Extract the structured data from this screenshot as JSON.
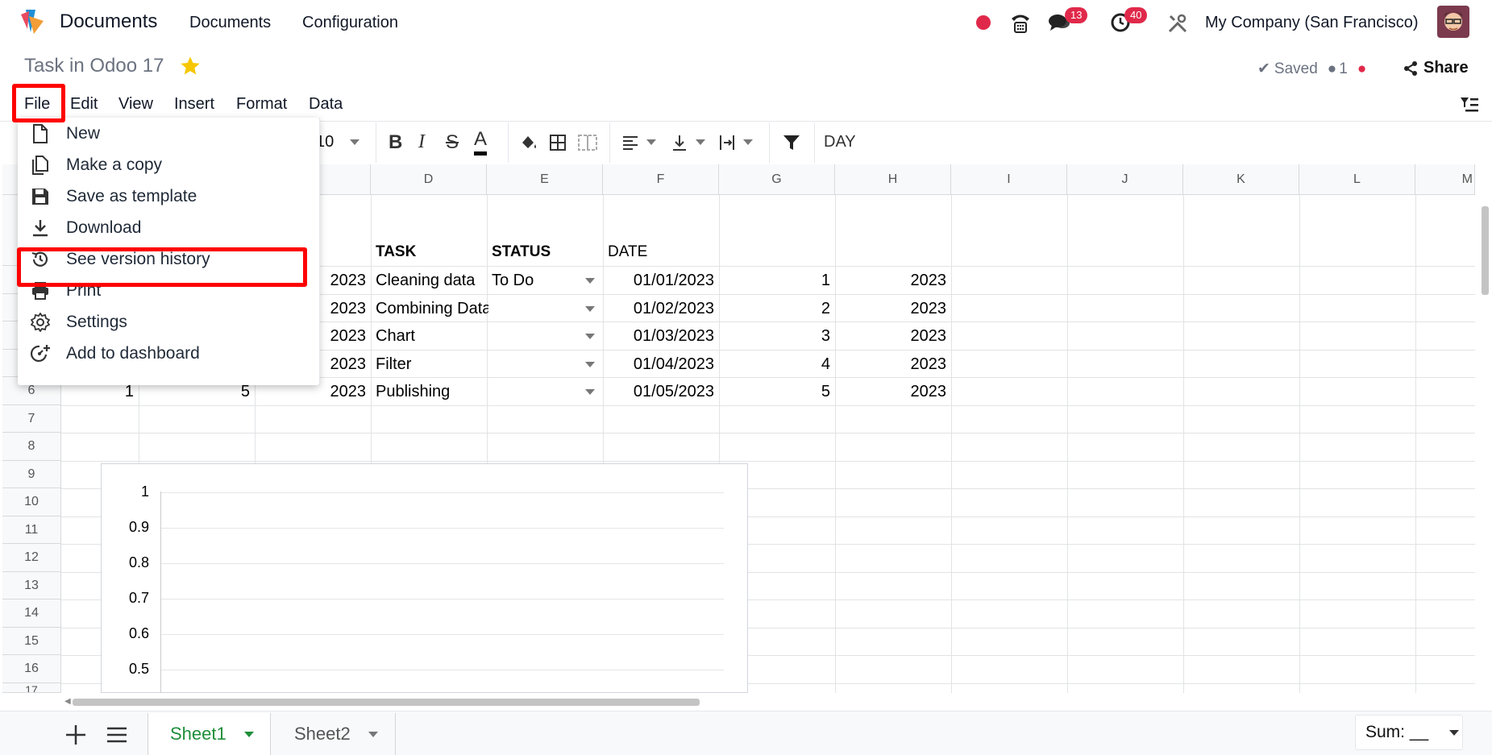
{
  "app": {
    "name": "Documents"
  },
  "topnav": {
    "menu_documents": "Documents",
    "menu_configuration": "Configuration",
    "chat_badge": "13",
    "activity_badge": "40",
    "company": "My Company (San Francisco)"
  },
  "doc": {
    "title": "Task in Odoo 17",
    "saved": "Saved",
    "users": "1",
    "share": "Share"
  },
  "menubar": {
    "file": "File",
    "edit": "Edit",
    "view": "View",
    "insert": "Insert",
    "format": "Format",
    "data": "Data"
  },
  "toolbar": {
    "font_size": "10",
    "cell_content": "DAY"
  },
  "file_menu": {
    "items": [
      {
        "label": "New",
        "icon": "file-icon"
      },
      {
        "label": "Make a copy",
        "icon": "copy-icon"
      },
      {
        "label": "Save as template",
        "icon": "save-icon"
      },
      {
        "label": "Download",
        "icon": "download-icon"
      },
      {
        "label": "See version history",
        "icon": "history-icon"
      },
      {
        "label": "Print",
        "icon": "print-icon"
      },
      {
        "label": "Settings",
        "icon": "gear-icon"
      },
      {
        "label": "Add to dashboard",
        "icon": "dashboard-add-icon"
      }
    ]
  },
  "sheet": {
    "columns": [
      "D",
      "E",
      "F",
      "G",
      "H",
      "I",
      "J",
      "K",
      "L",
      "M"
    ],
    "rows": [
      "6",
      "7",
      "8",
      "9",
      "10",
      "11",
      "12",
      "13",
      "14",
      "15",
      "16",
      "17"
    ],
    "headers": {
      "task": "TASK",
      "status": "STATUS",
      "date": "DATE"
    },
    "data": [
      {
        "c": "2023",
        "task": "Cleaning data",
        "status": "To Do",
        "date": "01/01/2023",
        "g": "1",
        "h": "2023"
      },
      {
        "c": "2023",
        "task": "Combining Data",
        "status": "",
        "date": "01/02/2023",
        "g": "2",
        "h": "2023"
      },
      {
        "c": "2023",
        "task": "Chart",
        "status": "",
        "date": "01/03/2023",
        "g": "3",
        "h": "2023"
      },
      {
        "c": "2023",
        "task": "Filter",
        "status": "",
        "date": "01/04/2023",
        "g": "4",
        "h": "2023"
      },
      {
        "c": "2023",
        "task": "Publishing",
        "status": "",
        "date": "01/05/2023",
        "g": "5",
        "h": "2023"
      }
    ],
    "row6_a": "1",
    "row6_b": "5"
  },
  "chart": {
    "yticks": [
      "1",
      "0.9",
      "0.8",
      "0.7",
      "0.6",
      "0.5"
    ]
  },
  "chart_data": {
    "type": "line",
    "ylim": [
      0.5,
      1
    ],
    "yticks": [
      1,
      0.9,
      0.8,
      0.7,
      0.6,
      0.5
    ],
    "series": []
  },
  "bottom": {
    "sheets": [
      "Sheet1",
      "Sheet2"
    ],
    "sum_label": "Sum: __"
  },
  "colors": {
    "active_sheet": "#1f8f3a",
    "badge": "#e0294a",
    "highlight": "#ff0000"
  }
}
